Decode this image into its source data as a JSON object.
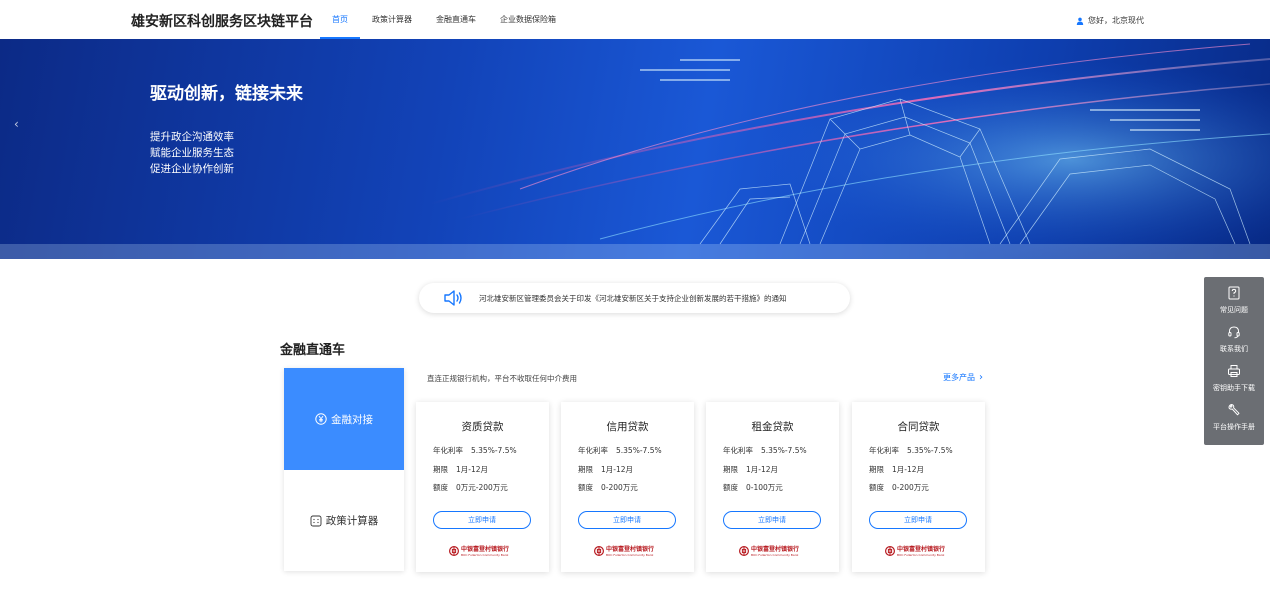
{
  "header": {
    "site_title": "雄安新区科创服务区块链平台",
    "nav": [
      "首页",
      "政策计算器",
      "金融直通车",
      "企业数据保险箱"
    ],
    "active_nav": "首页",
    "user_greeting": "您好，北京现代"
  },
  "banner": {
    "title": "驱动创新，链接未来",
    "lines": [
      "提升政企沟通效率",
      "赋能企业服务生态",
      "促进企业协作创新"
    ],
    "prev_icon": "chevron-left-icon"
  },
  "notice": {
    "icon": "speaker-icon",
    "text": "河北雄安新区管理委员会关于印发《河北雄安新区关于支持企业创新发展的若干措施》的通知"
  },
  "section": {
    "title": "金融直通车",
    "tabs": [
      {
        "label": "金融对接",
        "icon": "yuan-icon",
        "active": true
      },
      {
        "label": "政策计算器",
        "icon": "calculator-icon",
        "active": false
      }
    ],
    "description": "直连正规银行机构，平台不收取任何中介费用",
    "more_label": "更多产品"
  },
  "products": [
    {
      "title": "资质贷款",
      "rate_label": "年化利率",
      "rate": "5.35%-7.5%",
      "term_label": "期限",
      "term": "1月-12月",
      "amount_label": "额度",
      "amount": "0万元-200万元",
      "apply_label": "立即申请",
      "bank": "中银富登村镇银行",
      "bank_en": "BOC Fullerton Community Bank"
    },
    {
      "title": "信用贷款",
      "rate_label": "年化利率",
      "rate": "5.35%-7.5%",
      "term_label": "期限",
      "term": "1月-12月",
      "amount_label": "额度",
      "amount": "0-200万元",
      "apply_label": "立即申请",
      "bank": "中银富登村镇银行",
      "bank_en": "BOC Fullerton Community Bank"
    },
    {
      "title": "租金贷款",
      "rate_label": "年化利率",
      "rate": "5.35%-7.5%",
      "term_label": "期限",
      "term": "1月-12月",
      "amount_label": "额度",
      "amount": "0-100万元",
      "apply_label": "立即申请",
      "bank": "中银富登村镇银行",
      "bank_en": "BOC Fullerton Community Bank"
    },
    {
      "title": "合同贷款",
      "rate_label": "年化利率",
      "rate": "5.35%-7.5%",
      "term_label": "期限",
      "term": "1月-12月",
      "amount_label": "额度",
      "amount": "0-200万元",
      "apply_label": "立即申请",
      "bank": "中银富登村镇银行",
      "bank_en": "BOC Fullerton Community Bank"
    }
  ],
  "side_panel": [
    {
      "label": "常见问题",
      "icon": "question-icon"
    },
    {
      "label": "联系我们",
      "icon": "headset-icon"
    },
    {
      "label": "密钥助手下载",
      "icon": "printer-icon"
    },
    {
      "label": "平台操作手册",
      "icon": "wrench-icon"
    }
  ],
  "colors": {
    "accent": "#1677ff",
    "tab_active": "#3b8cff",
    "side_panel": "#6b6e73",
    "bank_red": "#b81c22"
  }
}
